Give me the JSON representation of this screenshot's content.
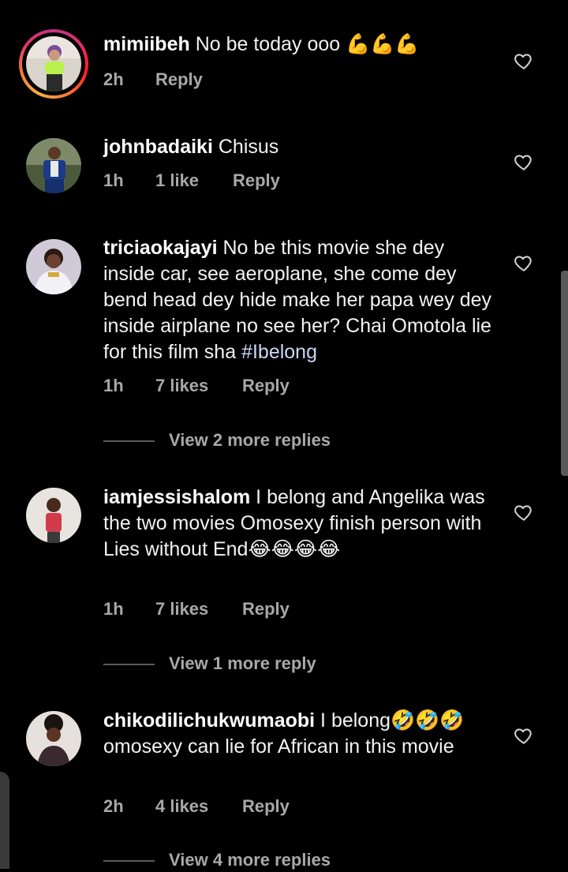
{
  "colors": {
    "background": "#000000",
    "text": "#f2f2f2",
    "muted": "#a8a8a8",
    "hashtag": "#c9d8f6",
    "story_ring": "#e1306c"
  },
  "comments": [
    {
      "username": "mimiibeh",
      "text": "No be today ooo 💪💪💪",
      "time": "2h",
      "likes": "",
      "reply_label": "Reply",
      "has_story": true,
      "like_icon": "heart-outline-icon"
    },
    {
      "username": "johnbadaiki",
      "text": "Chisus",
      "time": "1h",
      "likes": "1 like",
      "reply_label": "Reply",
      "like_icon": "heart-outline-icon"
    },
    {
      "username": "triciaokajayi",
      "text": "No be this movie she dey inside car, see aeroplane, she come dey bend head dey hide make her papa wey dey inside airplane no see her? Chai Omotola lie for this film sha",
      "hashtag": "#Ibelong",
      "time": "1h",
      "likes": "7 likes",
      "reply_label": "Reply",
      "view_replies": "View 2 more replies",
      "like_icon": "heart-outline-icon"
    },
    {
      "username": "iamjessishalom",
      "text": "I belong and Angelika was the two movies Omosexy finish person with Lies without End😂😂😂😂",
      "time": "1h",
      "likes": "7 likes",
      "reply_label": "Reply",
      "view_replies": "View 1 more reply",
      "like_icon": "heart-outline-icon"
    },
    {
      "username": "chikodilichukwumaobi",
      "text": "I belong🤣🤣🤣omosexy can lie for African in this movie",
      "time": "2h",
      "likes": "4 likes",
      "reply_label": "Reply",
      "view_replies": "View 4 more replies",
      "like_icon": "heart-outline-icon"
    }
  ]
}
